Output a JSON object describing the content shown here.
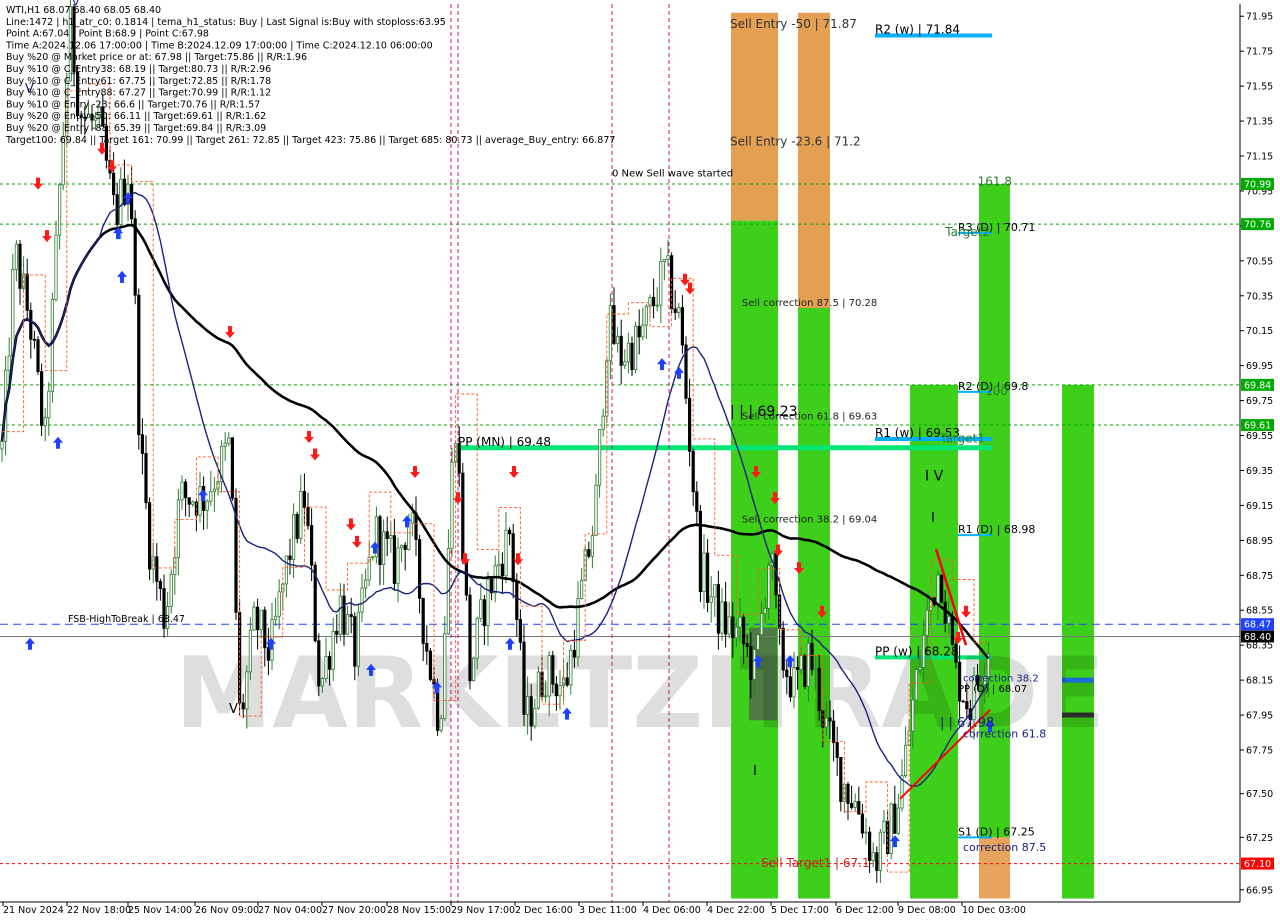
{
  "info_lines": [
    "WTI,H1  68.07 68.40 68.05 68.40",
    "Line:1472  |  h1_atr_c0: 0.1814  |  tema_h1_status: Buy  |  Last Signal is:Buy with stoploss:63.95",
    "Point A:67.04  |  Point B:68.9  |  Point C:67.98",
    "Time A:2024.12.06 17:00:00  |  Time B:2024.12.09 17:00:00  |  Time C:2024.12.10 06:00:00",
    "Buy %20 @ Market price or at: 67.98  ||  Target:75.86  ||  R/R:1.96",
    "Buy %10 @ C_Entry38: 68.19  ||  Target:80.73  ||  R/R:2.96",
    "Buy %10 @ C_Entry61: 67.75  ||  Target:72.85  ||  R/R:1.78",
    "Buy %10 @ C_Entry88: 67.27  ||  Target:70.99  ||  R/R:1.12",
    "Buy %10 @ Entry -23: 66.6  ||  Target:70.76  ||  R/R:1.57",
    "Buy %20 @ Entry -50: 66.11  ||  Target:69.61  ||  R/R:1.62",
    "Buy %20 @ Entry -88: 65.39  ||  Target:69.84  ||  R/R:3.09",
    "Target100: 69.84  ||  Target 161: 70.99  ||  Target 261: 72.85  ||  Target 423: 75.86  ||  Target 685: 80.73  ||  average_Buy_entry: 66.877"
  ],
  "watermark": "MARKETZITRADE",
  "colors": {
    "bg": "#ffffff",
    "bull": "#2e7d32",
    "bear": "#000000",
    "ma_slow": "#000000",
    "ma_fast": "#1a237e",
    "band": "#ff5722",
    "green_zone": "#3ecf1a",
    "orange_zone": "#e39a4a",
    "pivot": "#00e676",
    "weekly": "#00b0ff",
    "arrow_up": "#1e40ff",
    "arrow_down": "#ff1a1a",
    "grid_green": "#00aa00"
  },
  "chart_data": {
    "type": "candlestick",
    "symbol": "WTI",
    "timeframe": "H1",
    "ylim": [
      66.88,
      72.02
    ],
    "y_ticks": [
      66.95,
      67.25,
      67.5,
      67.75,
      67.95,
      68.15,
      68.35,
      68.55,
      68.75,
      68.95,
      69.15,
      69.35,
      69.55,
      69.75,
      69.95,
      70.15,
      70.35,
      70.55,
      70.75,
      70.95,
      71.15,
      71.35,
      71.55,
      71.75,
      71.95
    ],
    "x_labels": [
      "21 Nov 2024",
      "22 Nov 18:00",
      "25 Nov 14:00",
      "26 Nov 09:00",
      "27 Nov 04:00",
      "27 Nov 20:00",
      "28 Nov 15:00",
      "29 Nov 17:00",
      "2 Dec 16:00",
      "3 Dec 11:00",
      "4 Dec 06:00",
      "4 Dec 22:00",
      "5 Dec 17:00",
      "6 Dec 12:00",
      "9 Dec 08:00",
      "10 Dec 03:00"
    ],
    "price_path": [
      [
        0,
        69.3
      ],
      [
        15,
        70.6
      ],
      [
        30,
        70.2
      ],
      [
        45,
        69.5
      ],
      [
        60,
        71.0
      ],
      [
        70,
        71.9
      ],
      [
        80,
        71.4
      ],
      [
        100,
        71.3
      ],
      [
        115,
        70.8
      ],
      [
        130,
        71.1
      ],
      [
        140,
        69.5
      ],
      [
        150,
        68.9
      ],
      [
        165,
        68.5
      ],
      [
        180,
        69.2
      ],
      [
        205,
        69.2
      ],
      [
        230,
        69.5
      ],
      [
        240,
        67.9
      ],
      [
        255,
        68.5
      ],
      [
        270,
        68.3
      ],
      [
        290,
        68.9
      ],
      [
        305,
        69.2
      ],
      [
        320,
        68.1
      ],
      [
        340,
        68.6
      ],
      [
        355,
        68.3
      ],
      [
        375,
        69.0
      ],
      [
        395,
        68.8
      ],
      [
        410,
        69.1
      ],
      [
        425,
        68.4
      ],
      [
        440,
        67.9
      ],
      [
        455,
        69.7
      ],
      [
        470,
        68.2
      ],
      [
        485,
        68.6
      ],
      [
        510,
        69.0
      ],
      [
        525,
        67.9
      ],
      [
        545,
        68.2
      ],
      [
        565,
        68.1
      ],
      [
        580,
        68.6
      ],
      [
        595,
        69.1
      ],
      [
        608,
        70.2
      ],
      [
        620,
        70.0
      ],
      [
        640,
        70.1
      ],
      [
        665,
        70.5
      ],
      [
        680,
        70.2
      ],
      [
        690,
        69.5
      ],
      [
        700,
        68.8
      ],
      [
        720,
        68.5
      ],
      [
        740,
        68.4
      ],
      [
        755,
        68.2
      ],
      [
        770,
        68.9
      ],
      [
        780,
        68.3
      ],
      [
        795,
        68.1
      ],
      [
        810,
        68.3
      ],
      [
        825,
        67.9
      ],
      [
        840,
        67.6
      ],
      [
        860,
        67.4
      ],
      [
        875,
        67.1
      ],
      [
        890,
        67.3
      ],
      [
        900,
        67.5
      ],
      [
        915,
        68.1
      ],
      [
        930,
        68.6
      ],
      [
        940,
        68.8
      ],
      [
        955,
        68.2
      ],
      [
        970,
        68.0
      ],
      [
        990,
        68.4
      ]
    ],
    "last_price": 68.4,
    "open": 68.07,
    "high": 68.4,
    "low": 68.05,
    "close": 68.4,
    "price_axis_labels": [
      {
        "value": 70.99,
        "label": "70.99",
        "bg": "#00aa00"
      },
      {
        "value": 70.76,
        "label": "70.76",
        "bg": "#00aa00"
      },
      {
        "value": 69.84,
        "label": "69.84",
        "bg": "#00aa00"
      },
      {
        "value": 69.61,
        "label": "69.61",
        "bg": "#00aa00"
      },
      {
        "value": 68.47,
        "label": "68.47",
        "bg": "#1e40ff"
      },
      {
        "value": 68.4,
        "label": "68.40",
        "bg": "#000000"
      },
      {
        "value": 67.1,
        "label": "67.10",
        "bg": "#ff0000"
      }
    ],
    "hlines": [
      {
        "value": 70.99,
        "color": "#00aa00",
        "style": "dotted"
      },
      {
        "value": 70.76,
        "color": "#00aa00",
        "style": "dotted"
      },
      {
        "value": 69.84,
        "color": "#00aa00",
        "style": "dotted"
      },
      {
        "value": 69.61,
        "color": "#00aa00",
        "style": "dotted"
      },
      {
        "value": 68.47,
        "color": "#1e40ff",
        "style": "dashed"
      },
      {
        "value": 68.4,
        "color": "#777777",
        "style": "solid"
      },
      {
        "value": 67.1,
        "color": "#ff0000",
        "style": "dotted"
      }
    ],
    "annotations": [
      {
        "text": "Sell Entry -50 | 71.87",
        "price": 71.87,
        "color": "#333333"
      },
      {
        "text": "Sell Entry -23.6 | 71.2",
        "price": 71.2,
        "color": "#333333"
      },
      {
        "text": "0 New Sell wave started",
        "price": 71.02,
        "color": "#000000"
      },
      {
        "text": "Sell correction 87.5 | 70.28",
        "price": 70.28,
        "color": "#222222"
      },
      {
        "text": "Sell correction 61.8 | 69.63",
        "price": 69.63,
        "color": "#222222"
      },
      {
        "text": "Sell correction 38.2 | 69.04",
        "price": 69.04,
        "color": "#222222"
      },
      {
        "text": "Sell Target1 | 67.1",
        "price": 67.07,
        "color": "#cc2222"
      },
      {
        "text": "| | | 69.23",
        "price": 69.65,
        "color": "#000000"
      },
      {
        "text": "PP (MN) | 69.48",
        "price": 69.48,
        "color": "#000000"
      },
      {
        "text": "R2 (w) | 71.84",
        "price": 71.84,
        "color": "#000000"
      },
      {
        "text": "R1 (w) | 69.53",
        "price": 69.53,
        "color": "#000000"
      },
      {
        "text": "PP (w) | 68.28",
        "price": 68.28,
        "color": "#000000"
      },
      {
        "text": "R3 (D) | 70.71",
        "price": 70.71,
        "color": "#000000"
      },
      {
        "text": "R2 (D) | 69.8",
        "price": 69.8,
        "color": "#000000"
      },
      {
        "text": "R1 (D) | 68.98",
        "price": 68.98,
        "color": "#000000"
      },
      {
        "text": "S1 (D) | 67.25",
        "price": 67.25,
        "color": "#000000"
      },
      {
        "text": "FSB-HighToBreak | 68.47",
        "price": 68.47,
        "color": "#000000"
      },
      {
        "text": "161.8",
        "price": 70.97,
        "color": "#2e7d32"
      },
      {
        "text": "Target2",
        "price": 70.68,
        "color": "#2e7d32"
      },
      {
        "text": "100",
        "price": 69.77,
        "color": "#2e7d32"
      },
      {
        "text": "Target1",
        "price": 69.5,
        "color": "#2e7d32"
      },
      {
        "text": "correction 38.2",
        "price": 68.13,
        "color": "#1a237e"
      },
      {
        "text": "PP (D) | 68.07",
        "price": 68.07,
        "color": "#000000"
      },
      {
        "text": "| | 67.98",
        "price": 67.87,
        "color": "#1a237e"
      },
      {
        "text": "correction 61.8",
        "price": 67.81,
        "color": "#1a237e"
      },
      {
        "text": "correction 87.5",
        "price": 67.16,
        "color": "#1a237e"
      },
      {
        "text": "I V",
        "price": 69.28,
        "color": "#000000"
      },
      {
        "text": "V",
        "price": 71.5,
        "color": "#1a237e"
      },
      {
        "text": "V",
        "price": 67.95,
        "color": "#000000"
      },
      {
        "text": "V",
        "price": 72.0,
        "color": "#1a237e"
      }
    ]
  }
}
